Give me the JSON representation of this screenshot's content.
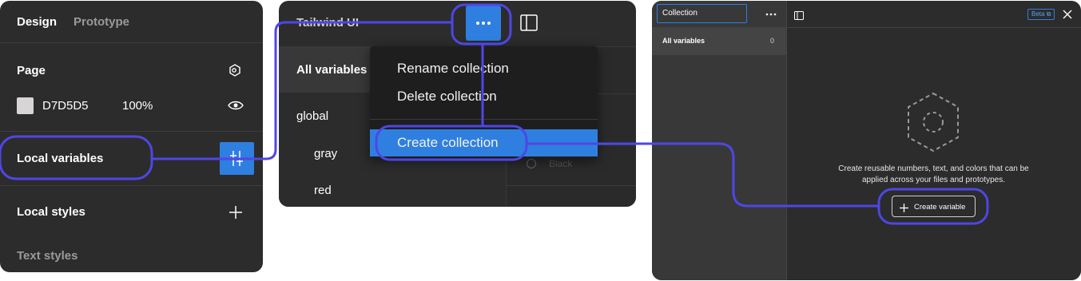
{
  "panel_design": {
    "tabs": [
      "Design",
      "Prototype"
    ],
    "page_heading": "Page",
    "page_color_hex": "D7D5D5",
    "page_color_swatch": "#d7d5d5",
    "page_opacity": "100%",
    "local_variables_label": "Local variables",
    "local_styles_label": "Local styles",
    "text_styles_label": "Text styles"
  },
  "panel_collection_menu": {
    "title": "Tailwind UI",
    "all_variables_label": "All variables",
    "groups": [
      "global",
      "gray",
      "red"
    ],
    "partial_row_text": "Black",
    "menu_items": [
      "Rename collection",
      "Delete collection",
      "Create collection"
    ]
  },
  "panel_variables": {
    "collection_name": "Collection",
    "all_variables_label": "All variables",
    "all_variables_count": "0",
    "beta_badge": "Beta",
    "empty_message_line1": "Create reusable numbers, text, and colors that can be",
    "empty_message_line2": "applied across your files and prototypes.",
    "create_variable_label": "Create variable"
  },
  "colors": {
    "panel_bg": "#2c2c2c",
    "accent_blue": "#2f7fe0",
    "highlight_purple": "#4f46e5"
  }
}
